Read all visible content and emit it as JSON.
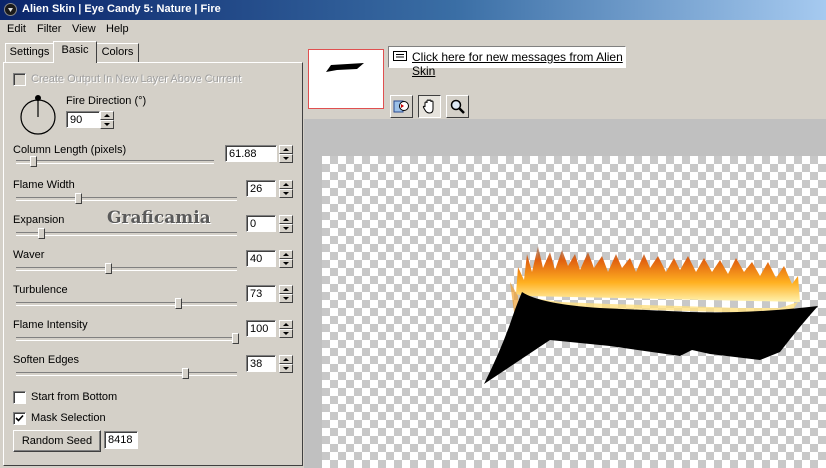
{
  "window": {
    "title": "Alien Skin | Eye Candy 5: Nature | Fire"
  },
  "menu": {
    "edit": "Edit",
    "filter": "Filter",
    "view": "View",
    "help": "Help"
  },
  "tabs": {
    "settings": "Settings",
    "basic": "Basic",
    "colors": "Colors",
    "active": "Basic"
  },
  "basic": {
    "create_output_label": "Create Output In New Layer Above Current",
    "create_output_checked": false,
    "create_output_enabled": false,
    "fire_direction_label": "Fire Direction (°)",
    "fire_direction_value": "90",
    "sliders": [
      {
        "label": "Column Length (pixels)",
        "value": "61.88"
      },
      {
        "label": "Flame Width",
        "value": "26"
      },
      {
        "label": "Expansion",
        "value": "0"
      },
      {
        "label": "Waver",
        "value": "40"
      },
      {
        "label": "Turbulence",
        "value": "73"
      },
      {
        "label": "Flame Intensity",
        "value": "100"
      },
      {
        "label": "Soften Edges",
        "value": "38"
      }
    ],
    "start_from_bottom_label": "Start from Bottom",
    "start_from_bottom_checked": false,
    "mask_selection_label": "Mask Selection",
    "mask_selection_checked": true,
    "random_seed_button": "Random Seed",
    "random_seed_value": "8418"
  },
  "watermark": "Graficamia",
  "messages": {
    "link_text": "Click here for new messages from Alien Skin"
  },
  "toolbar": {
    "tools": [
      "compare-icon",
      "hand-icon",
      "zoom-icon"
    ],
    "active_tool": "hand-icon"
  },
  "colors": {
    "title_start": "#0a246a",
    "title_end": "#a6caf0",
    "face": "#d4d0c8",
    "preview_border": "#e05050"
  }
}
